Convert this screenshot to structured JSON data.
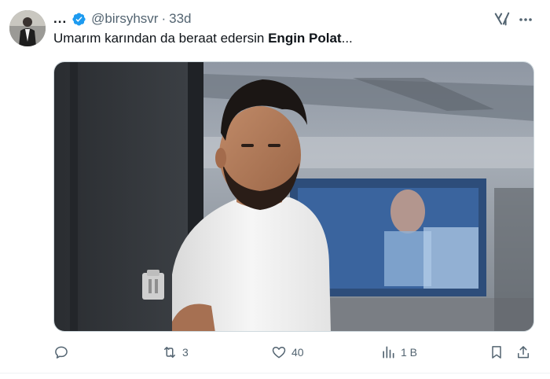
{
  "author": {
    "display_name": "...",
    "handle": "@birsyhsvr",
    "separator": "·",
    "time": "33d",
    "verified_color": "#1d9bf0"
  },
  "tweet": {
    "text_plain": "Umarım karından da beraat edersin ",
    "text_bold": "Engin Polat",
    "text_tail": "..."
  },
  "media": {
    "description_icon": "photo"
  },
  "actions": {
    "reply_count": "",
    "retweet_count": "3",
    "like_count": "40",
    "views_count": "1 B"
  },
  "icons": {
    "grok": "grok-icon",
    "more": "more-icon",
    "reply": "reply-icon",
    "retweet": "retweet-icon",
    "like": "heart-icon",
    "views": "views-icon",
    "bookmark": "bookmark-icon",
    "share": "share-icon"
  },
  "colors": {
    "text": "#0f1419",
    "secondary": "#536471",
    "border": "#cfd9de"
  }
}
